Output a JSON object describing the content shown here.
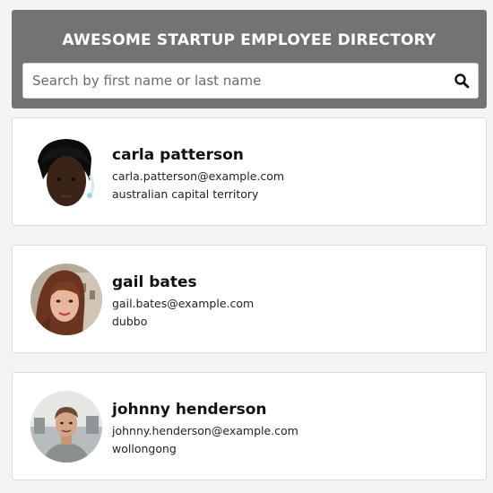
{
  "header": {
    "title": "AWESOME STARTUP EMPLOYEE DIRECTORY"
  },
  "search": {
    "placeholder": "Search by first name or last name",
    "value": "",
    "icon": "search-icon"
  },
  "employees": [
    {
      "name": "carla patterson",
      "email": "carla.patterson@example.com",
      "location": "australian capital territory",
      "avatar": "avatar-carla-patterson"
    },
    {
      "name": "gail bates",
      "email": "gail.bates@example.com",
      "location": "dubbo",
      "avatar": "avatar-gail-bates"
    },
    {
      "name": "johnny henderson",
      "email": "johnny.henderson@example.com",
      "location": "wollongong",
      "avatar": "avatar-johnny-henderson"
    }
  ]
}
